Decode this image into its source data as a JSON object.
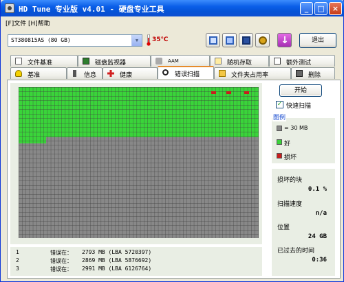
{
  "window": {
    "title": "HD Tune  专业版  v4.01 - 硬盘专业工具",
    "min_glyph": "_",
    "max_glyph": "□",
    "close_glyph": "×"
  },
  "menu": {
    "file": "[F]文件",
    "help": "[H]帮助"
  },
  "toolbar": {
    "drive": "ST380815AS (80 GB)",
    "temperature": "35℃",
    "exit_label": "退出",
    "download_glyph": "↓"
  },
  "tabs_row1": [
    {
      "label": "文件基准",
      "icon": "file-benchmark-icon"
    },
    {
      "label": "磁盘监视器",
      "icon": "disk-monitor-icon"
    },
    {
      "label": "AAM",
      "icon": "speaker-icon"
    },
    {
      "label": "随机存取",
      "icon": "random-access-icon"
    },
    {
      "label": "额外测试",
      "icon": "extra-tests-icon"
    }
  ],
  "tabs_row2": [
    {
      "label": "基准",
      "icon": "benchmark-icon"
    },
    {
      "label": "信息",
      "icon": "info-icon"
    },
    {
      "label": "健康",
      "icon": "health-icon"
    },
    {
      "label": "错误扫描",
      "icon": "error-scan-icon",
      "active": true
    },
    {
      "label": "文件夹占用率",
      "icon": "folder-usage-icon"
    },
    {
      "label": "删除",
      "icon": "erase-icon"
    }
  ],
  "scan": {
    "start_label": "开始",
    "quick_scan_label": "快速扫描",
    "quick_scan_checked": true,
    "quick_scan_check": "✓"
  },
  "legend": {
    "title": "图例",
    "block_size": "= 30 MB",
    "good": "好",
    "bad": "损坏",
    "colors": {
      "unscanned": "#888888",
      "good": "#3ad43a",
      "bad": "#c81d1d"
    }
  },
  "stats": {
    "damaged_blocks_label": "损坏的块",
    "damaged_blocks_value": "0.1 %",
    "scan_speed_label": "扫描速度",
    "scan_speed_value": "n/a",
    "position_label": "位置",
    "position_value": "24 GB",
    "elapsed_label": "已过去的时间",
    "elapsed_value": "0:36"
  },
  "errors": [
    {
      "index": "1",
      "label": "错误在：",
      "value": "2793 MB  (LBA 5720397)"
    },
    {
      "index": "2",
      "label": "错误在：",
      "value": "2869 MB  (LBA 5876692)"
    },
    {
      "index": "3",
      "label": "错误在：",
      "value": "2991 MB  (LBA 6126764)"
    }
  ]
}
